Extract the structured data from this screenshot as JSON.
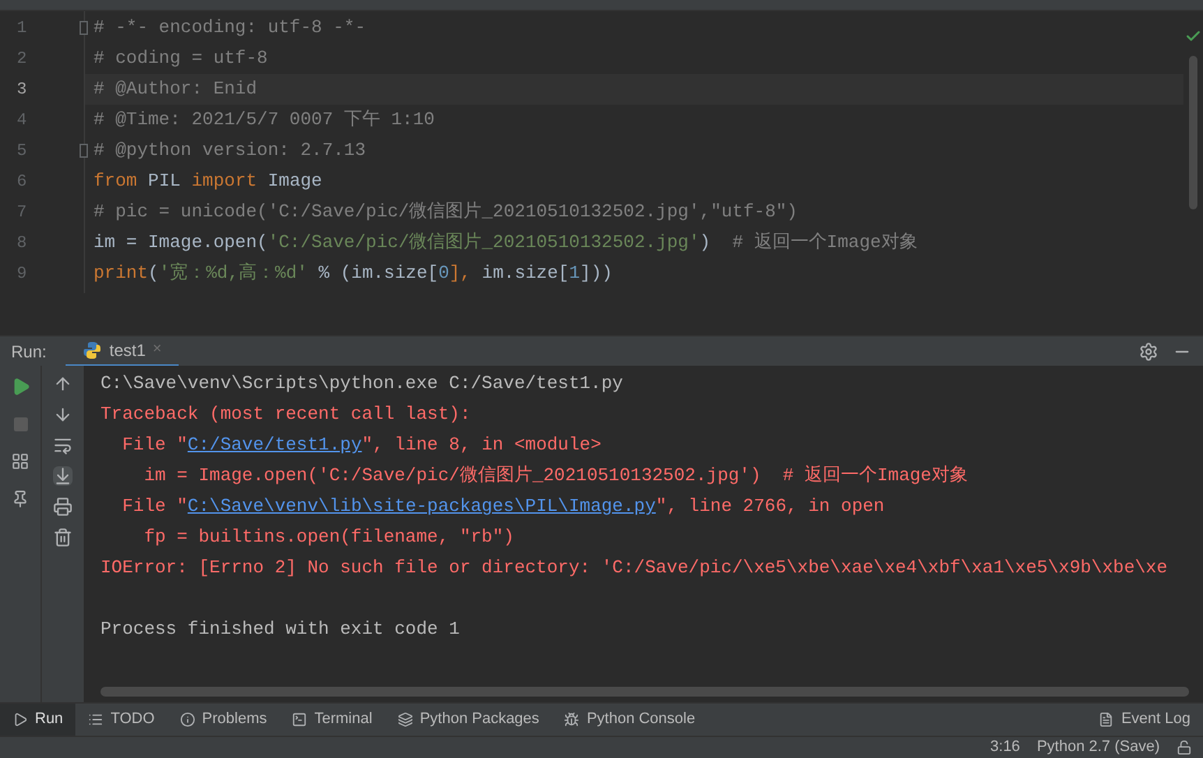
{
  "editor": {
    "lines": [
      {
        "number": "1",
        "current": false,
        "fold": true,
        "tokens": [
          {
            "kind": "comment",
            "text": "# -*- encoding: utf-8 -*-"
          }
        ]
      },
      {
        "number": "2",
        "current": false,
        "fold": false,
        "tokens": [
          {
            "kind": "comment",
            "text": "# coding = utf-8"
          }
        ]
      },
      {
        "number": "3",
        "current": true,
        "fold": false,
        "tokens": [
          {
            "kind": "comment",
            "text": "# @Author: Enid"
          }
        ]
      },
      {
        "number": "4",
        "current": false,
        "fold": false,
        "tokens": [
          {
            "kind": "comment",
            "text": "# @Time: 2021/5/7 0007 下午 1:10"
          }
        ]
      },
      {
        "number": "5",
        "current": false,
        "fold": true,
        "tokens": [
          {
            "kind": "comment",
            "text": "# @python version: 2.7.13"
          }
        ]
      },
      {
        "number": "6",
        "current": false,
        "fold": false,
        "tokens": [
          {
            "kind": "keyword",
            "text": "from"
          },
          {
            "kind": "plain",
            "text": " PIL "
          },
          {
            "kind": "keyword",
            "text": "import"
          },
          {
            "kind": "plain",
            "text": " Image"
          }
        ]
      },
      {
        "number": "7",
        "current": false,
        "fold": false,
        "tokens": [
          {
            "kind": "comment",
            "text": "# pic = unicode('C:/Save/pic/微信图片_20210510132502.jpg',\"utf-8\")"
          }
        ]
      },
      {
        "number": "8",
        "current": false,
        "fold": false,
        "tokens": [
          {
            "kind": "plain",
            "text": "im = Image.open("
          },
          {
            "kind": "string",
            "text": "'C:/Save/pic/微信图片_20210510132502.jpg'"
          },
          {
            "kind": "plain",
            "text": ")  "
          },
          {
            "kind": "comment",
            "text": "# 返回一个Image对象"
          }
        ]
      },
      {
        "number": "9",
        "current": false,
        "fold": false,
        "tokens": [
          {
            "kind": "keyword",
            "text": "print"
          },
          {
            "kind": "plain",
            "text": "("
          },
          {
            "kind": "string",
            "text": "'宽：%d,高：%d'"
          },
          {
            "kind": "plain",
            "text": " % (im.size["
          },
          {
            "kind": "number",
            "text": "0"
          },
          {
            "kind": "keyword",
            "text": "],"
          },
          {
            "kind": "plain",
            "text": " im.size["
          },
          {
            "kind": "number",
            "text": "1"
          },
          {
            "kind": "plain",
            "text": "]))"
          }
        ]
      }
    ]
  },
  "run_panel": {
    "label": "Run:",
    "tabs": [
      {
        "label": "test1",
        "selected": true,
        "close": "×"
      }
    ],
    "console": [
      {
        "tokens": [
          {
            "kind": "plain",
            "text": "C:\\Save\\venv\\Scripts\\python.exe C:/Save/test1.py"
          }
        ]
      },
      {
        "tokens": [
          {
            "kind": "error",
            "text": "Traceback (most recent call last):"
          }
        ]
      },
      {
        "tokens": [
          {
            "kind": "error",
            "text": "  File \""
          },
          {
            "kind": "link",
            "text": "C:/Save/test1.py"
          },
          {
            "kind": "error",
            "text": "\", line 8, in <module>"
          }
        ]
      },
      {
        "tokens": [
          {
            "kind": "error",
            "text": "    im = Image.open('C:/Save/pic/微信图片_20210510132502.jpg')  # 返回一个Image对象"
          }
        ]
      },
      {
        "tokens": [
          {
            "kind": "error",
            "text": "  File \""
          },
          {
            "kind": "link",
            "text": "C:\\Save\\venv\\lib\\site-packages\\PIL\\Image.py"
          },
          {
            "kind": "error",
            "text": "\", line 2766, in open"
          }
        ]
      },
      {
        "tokens": [
          {
            "kind": "error",
            "text": "    fp = builtins.open(filename, \"rb\")"
          }
        ]
      },
      {
        "tokens": [
          {
            "kind": "error",
            "text": "IOError: [Errno 2] No such file or directory: 'C:/Save/pic/\\xe5\\xbe\\xae\\xe4\\xbf\\xa1\\xe5\\x9b\\xbe\\xe"
          }
        ]
      }
    ],
    "exit_message": "Process finished with exit code 1"
  },
  "tool_windows": [
    {
      "label": "Run",
      "selected": true
    },
    {
      "label": "TODO",
      "selected": false
    },
    {
      "label": "Problems",
      "selected": false
    },
    {
      "label": "Terminal",
      "selected": false
    },
    {
      "label": "Python Packages",
      "selected": false
    },
    {
      "label": "Python Console",
      "selected": false
    },
    {
      "label": "Event Log",
      "selected": false
    }
  ],
  "status_bar": {
    "position": "3:16",
    "interpreter": "Python 2.7 (Save)"
  }
}
